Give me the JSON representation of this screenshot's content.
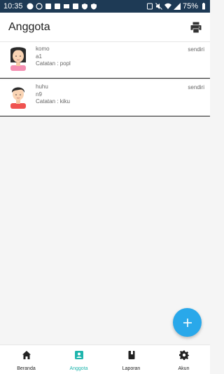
{
  "status_bar": {
    "time": "10:35",
    "battery": "75%",
    "background": "#1e3a55"
  },
  "app_bar": {
    "title": "Anggota",
    "print_icon": "print-icon"
  },
  "members": [
    {
      "name": "komo",
      "code": "a1",
      "note": "Catatan : popl",
      "status": "sendiri",
      "avatar": "female-avatar"
    },
    {
      "name": "huhu",
      "code": "n9",
      "note": "Catatan : kiku",
      "status": "sendiri",
      "avatar": "male-avatar"
    }
  ],
  "fab": {
    "icon": "plus-icon",
    "color": "#29a8ea"
  },
  "bottom_nav": {
    "items": [
      {
        "label": "Beranda",
        "icon": "home-icon",
        "active": false
      },
      {
        "label": "Anggota",
        "icon": "person-badge-icon",
        "active": true
      },
      {
        "label": "Laporan",
        "icon": "book-icon",
        "active": false
      },
      {
        "label": "Akun",
        "icon": "gear-icon",
        "active": false
      }
    ],
    "active_color": "#1fb5ad"
  }
}
